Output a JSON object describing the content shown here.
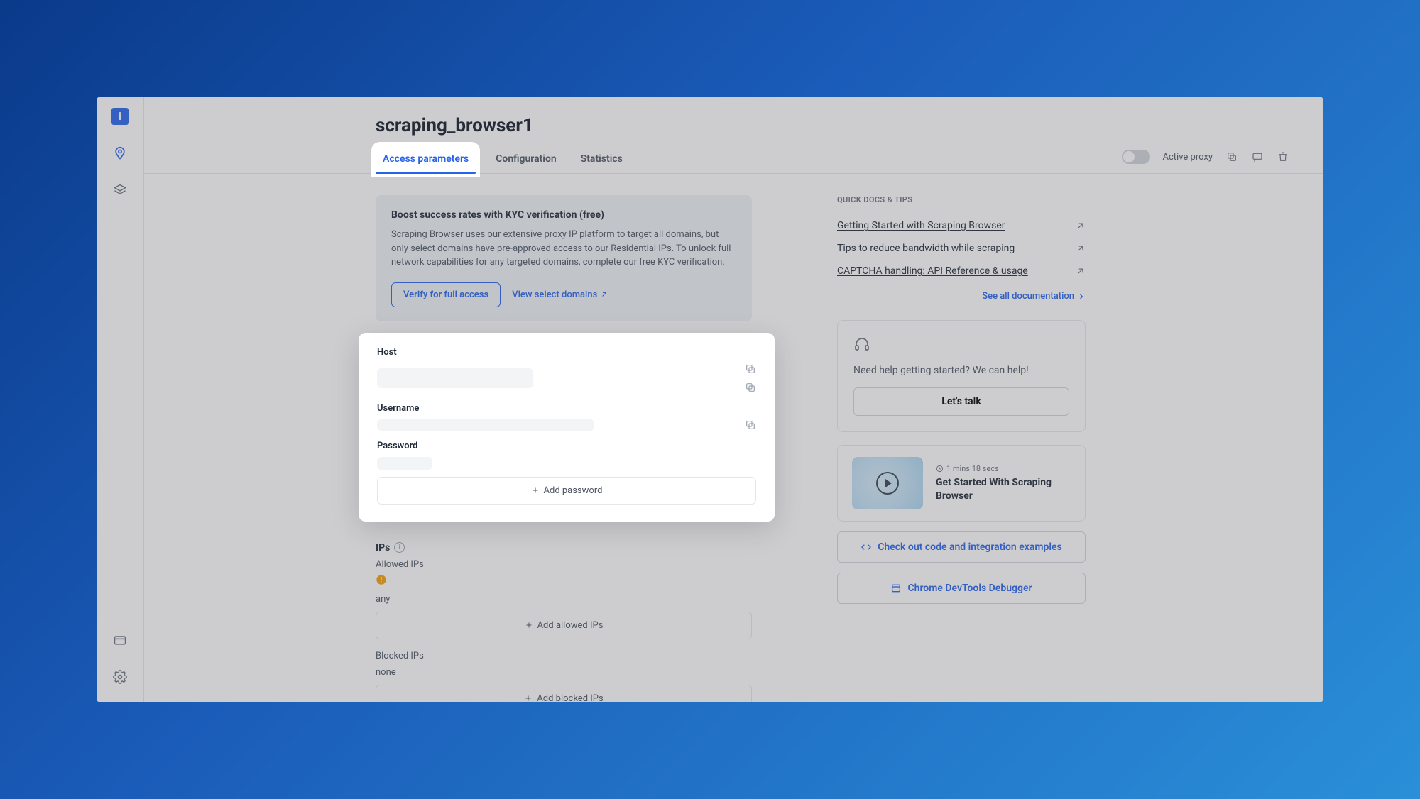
{
  "page_title": "scraping_browser1",
  "tabs": {
    "access": "Access parameters",
    "config": "Configuration",
    "stats": "Statistics"
  },
  "toolbar": {
    "active_proxy": "Active proxy"
  },
  "banner": {
    "title": "Boost success rates with KYC verification (free)",
    "text": "Scraping Browser uses our extensive proxy IP platform to target all domains, but only select domains have pre-approved access to our Residential IPs. To unlock full network capabilities for any targeted domains, complete our free KYC verification.",
    "verify_btn": "Verify for full access",
    "view_domains": "View select domains"
  },
  "cred": {
    "host_label": "Host",
    "user_label": "Username",
    "pass_label": "Password",
    "add_password": "Add password"
  },
  "ips": {
    "title": "IPs",
    "allowed_label": "Allowed IPs",
    "allowed_val": "any",
    "blocked_label": "Blocked IPs",
    "blocked_val": "none",
    "add_allowed": "Add allowed IPs",
    "add_blocked": "Add blocked IPs"
  },
  "docs": {
    "header": "QUICK DOCS & TIPS",
    "link1": "Getting Started with Scraping Browser",
    "link2": "Tips to reduce bandwidth while scraping",
    "link3": "CAPTCHA handling: API Reference & usage",
    "see_all": "See all documentation"
  },
  "help": {
    "text": "Need help getting started? We can help!",
    "cta": "Let's talk"
  },
  "video": {
    "time": "1 mins 18 secs",
    "title": "Get Started With Scraping Browser"
  },
  "cta_code": "Check out code and integration examples",
  "cta_debug": "Chrome DevTools Debugger"
}
